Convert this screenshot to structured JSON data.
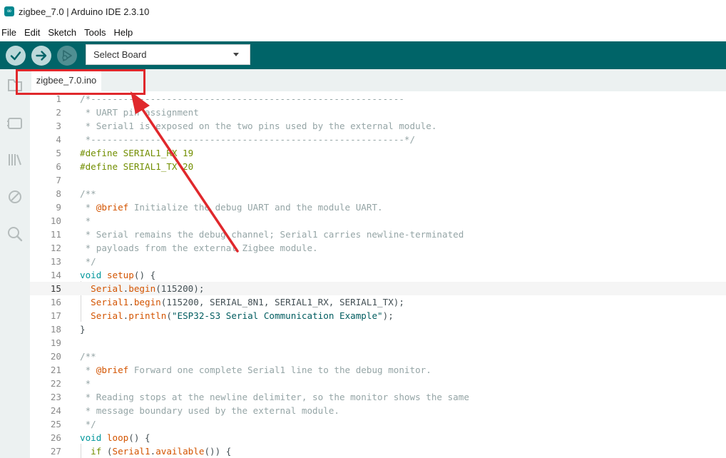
{
  "window": {
    "title": "zigbee_7.0 | Arduino IDE 2.3.10",
    "icon": "arduino-infinity-icon"
  },
  "menu": [
    "File",
    "Edit",
    "Sketch",
    "Tools",
    "Help"
  ],
  "toolbar": {
    "verify_icon": "checkmark-icon",
    "upload_icon": "arrow-right-icon",
    "debug_icon": "debugger-icon",
    "board_select": "Select Board",
    "accent": "#006468"
  },
  "sidebar": {
    "icons": [
      "folder-icon",
      "board-manager-icon",
      "library-icon",
      "debug-ban-icon",
      "search-icon"
    ]
  },
  "tabs": [
    {
      "label": "zigbee_7.0.ino",
      "active": true
    }
  ],
  "editor": {
    "current_line": 15,
    "lines": [
      {
        "n": "1",
        "tokens": [
          {
            "t": "/*----------------------------------------------------------",
            "c": "comment"
          }
        ]
      },
      {
        "n": "2",
        "tokens": [
          {
            "t": " * UART pin assignment",
            "c": "comment"
          }
        ]
      },
      {
        "n": "3",
        "tokens": [
          {
            "t": " * Serial1 is exposed on the two pins used by the external module.",
            "c": "comment"
          }
        ]
      },
      {
        "n": "4",
        "tokens": [
          {
            "t": " *----------------------------------------------------------*/",
            "c": "comment"
          }
        ]
      },
      {
        "n": "5",
        "tokens": [
          {
            "t": "#define SERIAL1_RX 19",
            "c": "preproc"
          }
        ]
      },
      {
        "n": "6",
        "tokens": [
          {
            "t": "#define SERIAL1_TX 20",
            "c": "preproc"
          }
        ]
      },
      {
        "n": "7",
        "tokens": []
      },
      {
        "n": "8",
        "tokens": [
          {
            "t": "/**",
            "c": "comment"
          }
        ]
      },
      {
        "n": "9",
        "tokens": [
          {
            "t": " * ",
            "c": "comment"
          },
          {
            "t": "@brief",
            "c": "tag"
          },
          {
            "t": " Initialize the debug UART and the module UART.",
            "c": "comment"
          }
        ]
      },
      {
        "n": "10",
        "tokens": [
          {
            "t": " *",
            "c": "comment"
          }
        ]
      },
      {
        "n": "11",
        "tokens": [
          {
            "t": " * Serial remains the debug channel; Serial1 carries newline-terminated",
            "c": "comment"
          }
        ]
      },
      {
        "n": "12",
        "tokens": [
          {
            "t": " * payloads from the external Zigbee module.",
            "c": "comment"
          }
        ]
      },
      {
        "n": "13",
        "tokens": [
          {
            "t": " */",
            "c": "comment"
          }
        ]
      },
      {
        "n": "14",
        "tokens": [
          {
            "t": "void",
            "c": "type"
          },
          {
            "t": " ",
            "c": "plain"
          },
          {
            "t": "setup",
            "c": "func"
          },
          {
            "t": "() {",
            "c": "plain"
          }
        ]
      },
      {
        "n": "15",
        "tokens": [
          {
            "t": "  ",
            "c": "plain"
          },
          {
            "t": "Serial",
            "c": "func"
          },
          {
            "t": ".",
            "c": "plain"
          },
          {
            "t": "begin",
            "c": "func"
          },
          {
            "t": "(115200);",
            "c": "plain"
          }
        ]
      },
      {
        "n": "16",
        "tokens": [
          {
            "t": "  ",
            "c": "plain"
          },
          {
            "t": "Serial1",
            "c": "func"
          },
          {
            "t": ".",
            "c": "plain"
          },
          {
            "t": "begin",
            "c": "func"
          },
          {
            "t": "(115200, SERIAL_8N1, SERIAL1_RX, SERIAL1_TX);",
            "c": "plain"
          }
        ]
      },
      {
        "n": "17",
        "tokens": [
          {
            "t": "  ",
            "c": "plain"
          },
          {
            "t": "Serial",
            "c": "func"
          },
          {
            "t": ".",
            "c": "plain"
          },
          {
            "t": "println",
            "c": "func"
          },
          {
            "t": "(",
            "c": "plain"
          },
          {
            "t": "\"ESP32-S3 Serial Communication Example\"",
            "c": "str"
          },
          {
            "t": ");",
            "c": "plain"
          }
        ]
      },
      {
        "n": "18",
        "tokens": [
          {
            "t": "}",
            "c": "plain"
          }
        ]
      },
      {
        "n": "19",
        "tokens": []
      },
      {
        "n": "20",
        "tokens": [
          {
            "t": "/**",
            "c": "comment"
          }
        ]
      },
      {
        "n": "21",
        "tokens": [
          {
            "t": " * ",
            "c": "comment"
          },
          {
            "t": "@brief",
            "c": "tag"
          },
          {
            "t": " Forward one complete Serial1 line to the debug monitor.",
            "c": "comment"
          }
        ]
      },
      {
        "n": "22",
        "tokens": [
          {
            "t": " *",
            "c": "comment"
          }
        ]
      },
      {
        "n": "23",
        "tokens": [
          {
            "t": " * Reading stops at the newline delimiter, so the monitor shows the same",
            "c": "comment"
          }
        ]
      },
      {
        "n": "24",
        "tokens": [
          {
            "t": " * message boundary used by the external module.",
            "c": "comment"
          }
        ]
      },
      {
        "n": "25",
        "tokens": [
          {
            "t": " */",
            "c": "comment"
          }
        ]
      },
      {
        "n": "26",
        "tokens": [
          {
            "t": "void",
            "c": "type"
          },
          {
            "t": " ",
            "c": "plain"
          },
          {
            "t": "loop",
            "c": "func"
          },
          {
            "t": "() {",
            "c": "plain"
          }
        ]
      },
      {
        "n": "27",
        "tokens": [
          {
            "t": "  ",
            "c": "plain"
          },
          {
            "t": "if",
            "c": "kw"
          },
          {
            "t": " (",
            "c": "plain"
          },
          {
            "t": "Serial1",
            "c": "func"
          },
          {
            "t": ".",
            "c": "plain"
          },
          {
            "t": "available",
            "c": "func"
          },
          {
            "t": "()) {",
            "c": "plain"
          }
        ]
      }
    ]
  },
  "annotation": {
    "color": "#e0282c",
    "target": "tab-zigbee-ino"
  }
}
